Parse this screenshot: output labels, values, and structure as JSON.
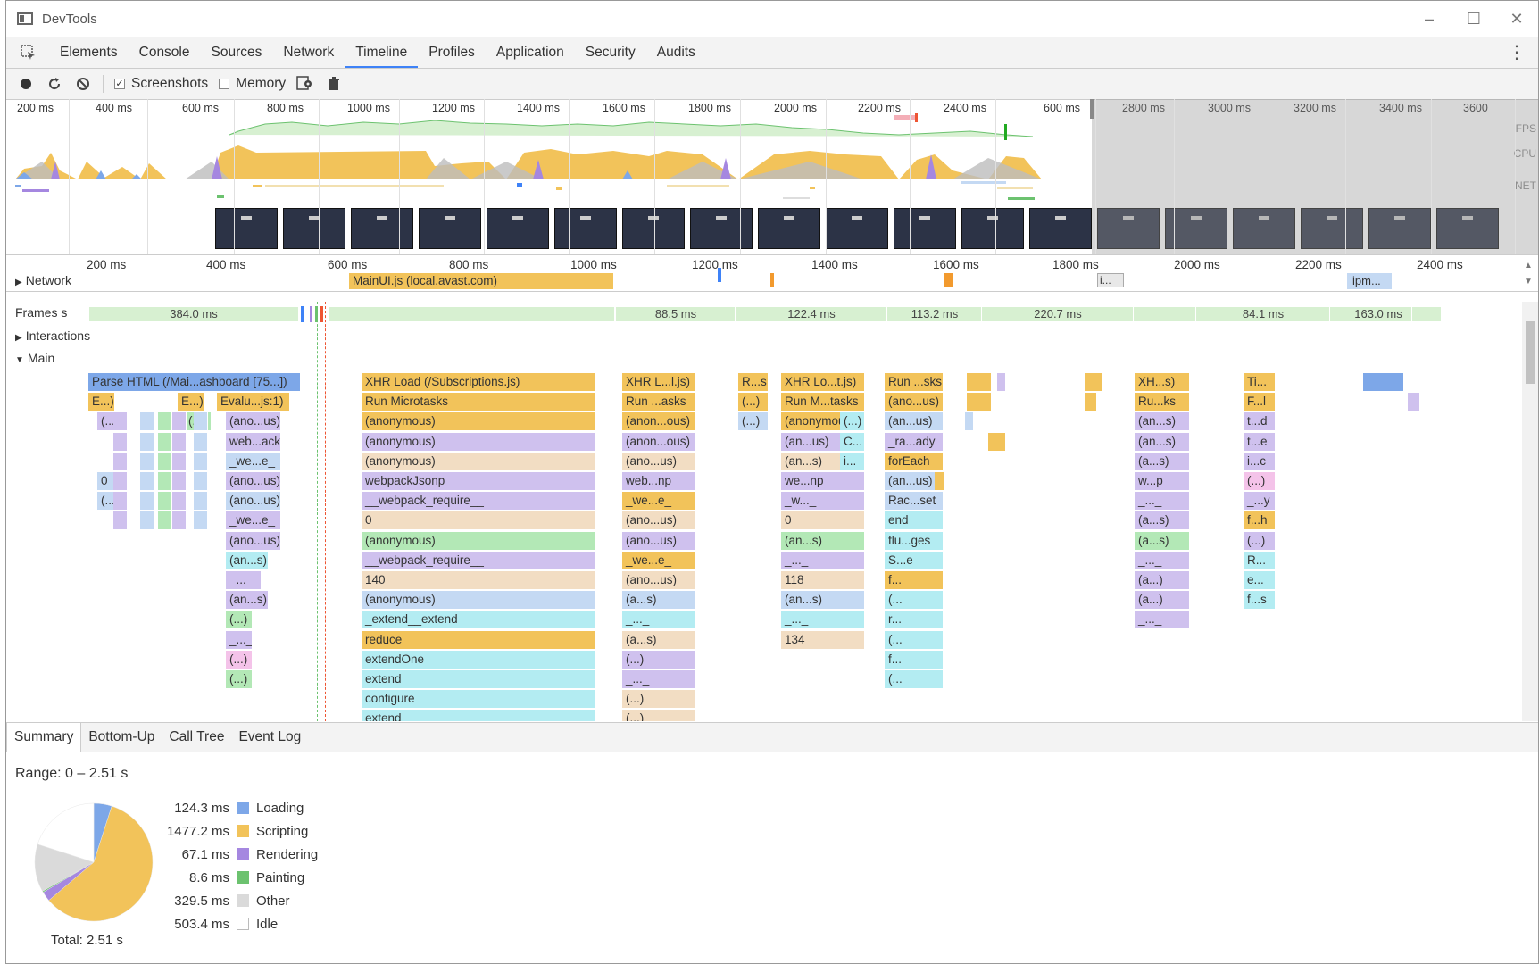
{
  "window": {
    "title": "DevTools"
  },
  "panel_tabs": [
    "Elements",
    "Console",
    "Sources",
    "Network",
    "Timeline",
    "Profiles",
    "Application",
    "Security",
    "Audits"
  ],
  "active_panel": "Timeline",
  "toolbar": {
    "screenshots_label": "Screenshots",
    "screenshots_checked": true,
    "memory_label": "Memory",
    "memory_checked": false
  },
  "overview": {
    "ticks": [
      "200 ms",
      "400 ms",
      "600 ms",
      "800 ms",
      "1000 ms",
      "1200 ms",
      "1400 ms",
      "1600 ms",
      "1800 ms",
      "2000 ms",
      "2200 ms",
      "2400 ms",
      "600 ms",
      "2800 ms",
      "3000 ms",
      "3200 ms",
      "3400 ms",
      "3600"
    ],
    "row_labels": [
      "FPS",
      "CPU",
      "NET"
    ]
  },
  "timeline_ruler": {
    "ticks": [
      "200 ms",
      "400 ms",
      "600 ms",
      "800 ms",
      "1000 ms",
      "1200 ms",
      "1400 ms",
      "1600 ms",
      "1800 ms",
      "2000 ms",
      "2200 ms",
      "2400 ms"
    ],
    "network_label": "Network",
    "network_items": [
      "MainUI.js (local.avast.com)",
      "i...",
      "ipm..."
    ]
  },
  "flame": {
    "frames_label": "Frames s",
    "frames": [
      "384.0 ms",
      "88.5 ms",
      "122.4 ms",
      "113.2 ms",
      "220.7 ms",
      "84.1 ms",
      "163.0 ms"
    ],
    "interactions_label": "Interactions",
    "main_label": "Main",
    "col1": [
      "Parse HTML (/Mai...ashboard [75...])",
      "E...)",
      "E...)",
      "Evalu...js:1)",
      "(...",
      "(...)",
      "(ano...us)",
      "web...ack",
      "_we...e_",
      "(ano...us)",
      "(ano...us)",
      "_we...e_",
      "(ano...us)",
      "(an...s)",
      "_..._",
      "(an...s)",
      "(...)",
      "_..._",
      "(...)",
      "(...)",
      "0",
      "(...)"
    ],
    "col2": [
      "XHR Load (/Subscriptions.js)",
      "Run Microtasks",
      "(anonymous)",
      "(anonymous)",
      "(anonymous)",
      "webpackJsonp",
      "__webpack_require__",
      "0",
      "(anonymous)",
      "__webpack_require__",
      "140",
      "(anonymous)",
      "_extend__extend",
      "reduce",
      "extendOne",
      "extend",
      "configure",
      "extend"
    ],
    "col3": [
      "XHR L...l.js)",
      "Run ...asks",
      "(anon...ous)",
      "(anon...ous)",
      "(ano...us)",
      "web...np",
      "_we...e_",
      "(ano...us)",
      "(ano...us)",
      "_we...e_",
      "(ano...us)",
      "(a...s)",
      "_..._",
      "(a...s)",
      "(...)",
      "_..._",
      "(...)",
      "(...)"
    ],
    "col4": [
      "R...s",
      "(...)",
      "(...)"
    ],
    "col5": [
      "XHR Lo...t.js)",
      "Run M...tasks",
      "(anonymous)",
      "(an...us)",
      "(an...s)",
      "we...np",
      "_w..._",
      "0",
      "(an...s)",
      "_..._",
      "118",
      "(an...s)",
      "_..._",
      "134"
    ],
    "col5b": [
      "(...)",
      "C...",
      "i..."
    ],
    "col6": [
      "Run ...sks",
      "(ano...us)",
      "(an...us)",
      "_ra...ady",
      "forEach",
      "(an...us)",
      "Rac...set",
      "end",
      "flu...ges",
      "S...e",
      "f...",
      "(...",
      "r...",
      "(...",
      "f...",
      "(..."
    ],
    "col7": [
      "XH...s)",
      "Ru...ks",
      "(an...s)",
      "(an...s)",
      "(a...s)",
      "w...p",
      "_..._",
      "(a...s)",
      "(a...s)",
      "_..._",
      "(a...)",
      "(a...)",
      "_..._"
    ],
    "col8": [
      "Ti...",
      "F...l",
      "t...d",
      "t...e",
      "i...c",
      "(...)",
      "_...y",
      "f...h",
      "(...)",
      "R...",
      "e...",
      "f...s"
    ]
  },
  "bottom_tabs": [
    "Summary",
    "Bottom-Up",
    "Call Tree",
    "Event Log"
  ],
  "summary": {
    "range": "Range: 0 – 2.51 s",
    "total": "Total: 2.51 s",
    "items": [
      {
        "value": "124.3 ms",
        "label": "Loading",
        "ms": 124.3,
        "color": "#7da7e8"
      },
      {
        "value": "1477.2 ms",
        "label": "Scripting",
        "ms": 1477.2,
        "color": "#f2c35a"
      },
      {
        "value": "67.1 ms",
        "label": "Rendering",
        "ms": 67.1,
        "color": "#a587e0"
      },
      {
        "value": "8.6 ms",
        "label": "Painting",
        "ms": 8.6,
        "color": "#6cc26f"
      },
      {
        "value": "329.5 ms",
        "label": "Other",
        "ms": 329.5,
        "color": "#dadada"
      },
      {
        "value": "503.4 ms",
        "label": "Idle",
        "ms": 503.4,
        "color": "#ffffff"
      }
    ]
  }
}
